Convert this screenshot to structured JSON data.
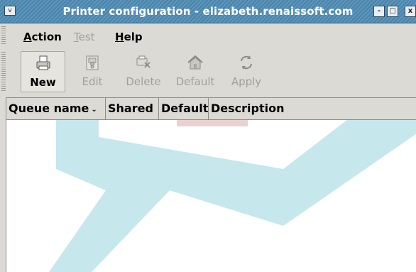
{
  "window": {
    "title": "Printer configuration - elizabeth.renaissoft.com",
    "menu_glyph": "v",
    "minimize_glyph": "-",
    "maximize_glyph": "□",
    "close_glyph": "x"
  },
  "menubar": {
    "items": [
      {
        "label": "Action",
        "mnemonic": "A",
        "rest": "ction",
        "enabled": true
      },
      {
        "label": "Test",
        "mnemonic": "T",
        "rest": "est",
        "enabled": false
      },
      {
        "label": "Help",
        "mnemonic": "H",
        "rest": "elp",
        "enabled": true
      }
    ]
  },
  "toolbar": {
    "items": [
      {
        "label": "New",
        "icon": "new-printer-icon",
        "enabled": true
      },
      {
        "label": "Edit",
        "icon": "edit-icon",
        "enabled": false
      },
      {
        "label": "Delete",
        "icon": "delete-icon",
        "enabled": false
      },
      {
        "label": "Default",
        "icon": "home-icon",
        "enabled": false
      },
      {
        "label": "Apply",
        "icon": "apply-icon",
        "enabled": false
      }
    ]
  },
  "table": {
    "columns": [
      {
        "label": "Queue name",
        "sort_glyph": "⌄"
      },
      {
        "label": "Shared"
      },
      {
        "label": "Default"
      },
      {
        "label": "Description"
      }
    ],
    "rows": []
  },
  "colors": {
    "titlebar": "#4d8ab3",
    "background": "#dcdad5",
    "disabled_text": "#a19f99",
    "watermark_red": "#e9d2d0",
    "watermark_blue": "#c6e7ec"
  }
}
